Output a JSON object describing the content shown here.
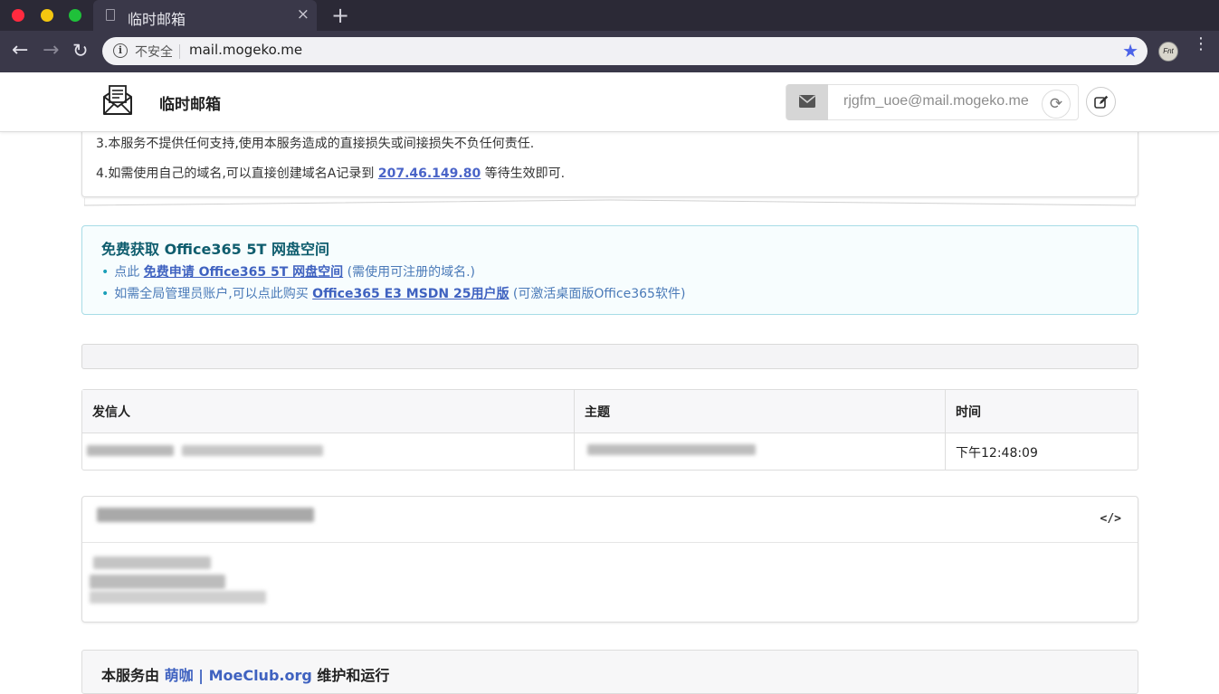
{
  "browser": {
    "tab_title": "临时邮箱",
    "tab_close": "×",
    "new_tab": "+",
    "back": "←",
    "forward": "→",
    "reload": "↻",
    "info": "i",
    "insecure_label": "不安全",
    "url": "mail.mogeko.me",
    "bookmark_star": "★",
    "profile_initials": "Fnt",
    "menu": "⋮"
  },
  "header": {
    "title": "临时邮箱",
    "mail_address": "rjgfm_uoe@mail.mogeko.me",
    "refresh": "⟳"
  },
  "notice": {
    "line3": "3.本服务不提供任何支持,使用本服务造成的直接损失或间接损失不负任何责任.",
    "line4_prefix": "4.如需使用自己的域名,可以直接创建域名A记录到 ",
    "line4_ip": "207.46.149.80",
    "line4_suffix": " 等待生效即可."
  },
  "info_box": {
    "title": "免费获取 Office365 5T 网盘空间",
    "item1_prefix": "点此 ",
    "item1_link": "免费申请 Office365 5T 网盘空间",
    "item1_suffix": " (需使用可注册的域名.)",
    "item2_prefix": "如需全局管理员账户,可以点此购买 ",
    "item2_link": "Office365 E3 MSDN 25用户版",
    "item2_suffix": " (可激活桌面版Office365软件)"
  },
  "table": {
    "headers": [
      "发信人",
      "主题",
      "时间"
    ],
    "rows": [
      {
        "time": "下午12:48:09"
      }
    ]
  },
  "message": {
    "view_source": "</>"
  },
  "footer": {
    "prefix": "本服务由 ",
    "link": "萌咖 | MoeClub.org",
    "suffix": " 维护和运行"
  },
  "colors": {
    "accent": "#3f62c0",
    "info_border": "#a7dce6",
    "chrome_bg": "#3a3849"
  }
}
